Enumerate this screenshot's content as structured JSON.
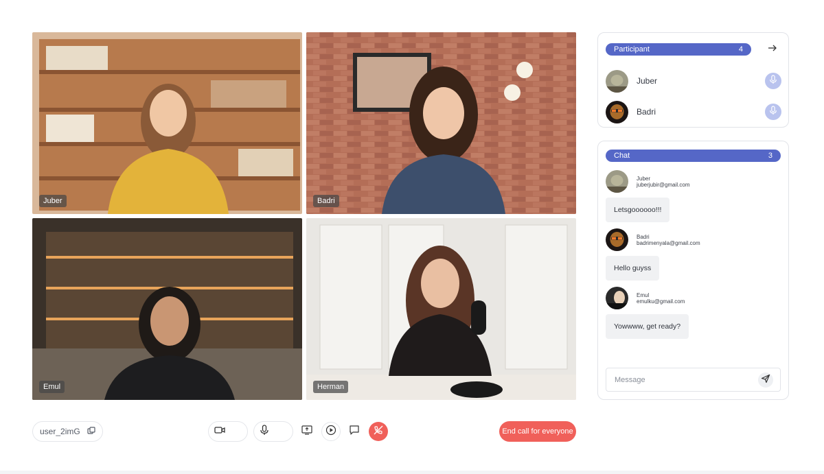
{
  "tiles": [
    {
      "name": "Juber"
    },
    {
      "name": "Badri"
    },
    {
      "name": "Emul"
    },
    {
      "name": "Herman"
    }
  ],
  "controls": {
    "user_id": "user_2imG",
    "end_call_label": "End call for everyone",
    "icons": [
      "copy-icon",
      "video-camera-icon",
      "microphone-icon",
      "screen-share-icon",
      "record-icon",
      "chat-icon",
      "end-call-icon"
    ]
  },
  "participants": {
    "title": "Participant",
    "count": "4",
    "list": [
      {
        "name": "Juber"
      },
      {
        "name": "Badri"
      }
    ]
  },
  "chat": {
    "title": "Chat",
    "count": "3",
    "messages": [
      {
        "name": "Juber",
        "email": "juberjubir@gmail.com",
        "text": "Letsgoooooo!!!"
      },
      {
        "name": "Badri",
        "email": "badrimenyala@gmail.com",
        "text": "Hello guyss"
      },
      {
        "name": "Emul",
        "email": "emulku@gmail.com",
        "text": "Yowwww, get ready?"
      }
    ],
    "input_placeholder": "Message"
  },
  "colors": {
    "accent": "#5567c7",
    "end_call": "#f0605a",
    "mic_badge": "#b9c3ee"
  }
}
